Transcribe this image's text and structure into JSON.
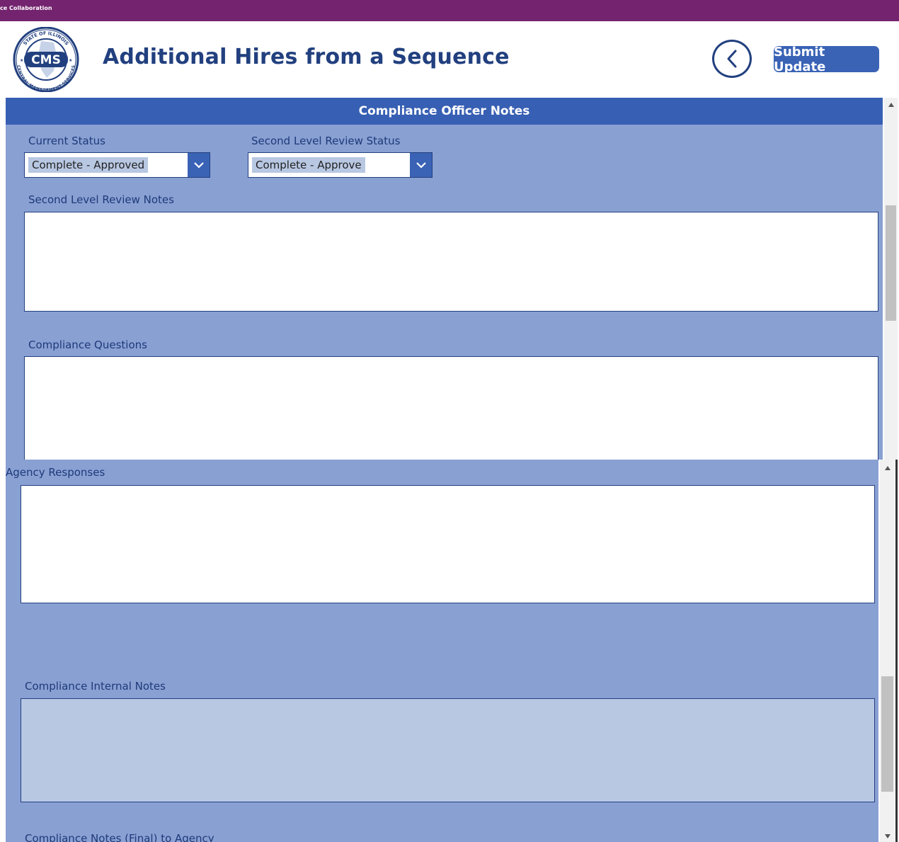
{
  "app": {
    "title": "ce Collaboration",
    "logo": {
      "text": "CMS",
      "ring_top": "STATE OF ILLINOIS",
      "ring_bottom": "CENTRAL MANAGEMENT SERVICES"
    }
  },
  "header": {
    "title": "Additional Hires from a Sequence",
    "submit_label": "Submit Update",
    "back_icon": "chevron-left-circle-icon"
  },
  "upper_panel": {
    "title": "Compliance Officer Notes",
    "current_status": {
      "label": "Current Status",
      "value": "Complete - Approved"
    },
    "second_level_status": {
      "label": "Second Level Review Status",
      "value": "Complete - Approve"
    },
    "second_level_notes": {
      "label": "Second Level Review Notes",
      "value": ""
    },
    "compliance_questions": {
      "label": "Compliance Questions",
      "value": ""
    }
  },
  "lower_panel": {
    "agency_responses": {
      "label": "Agency Responses",
      "value": ""
    },
    "internal_notes": {
      "label": "Compliance Internal Notes",
      "value": ""
    },
    "final_notes": {
      "label": "Compliance Notes (Final) to Agency"
    }
  },
  "colors": {
    "brand_purple": "#74246f",
    "title_blue": "#22407f",
    "button_blue": "#3a63b6",
    "panel_blue": "#89a0d3",
    "readonly_fill": "#b8c8e3"
  }
}
